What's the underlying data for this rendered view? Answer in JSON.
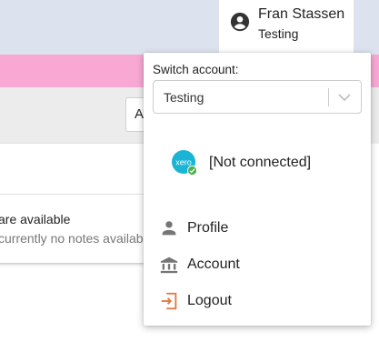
{
  "user": {
    "name": "Fran Stassen",
    "organisation": "Testing"
  },
  "menu": {
    "switch_label": "Switch account:",
    "selected_account": "Testing",
    "connection": {
      "status_text": "[Not connected]",
      "logo_text": "xero"
    },
    "items": [
      {
        "label": "Profile",
        "icon": "person-icon"
      },
      {
        "label": "Account",
        "icon": "bank-icon"
      },
      {
        "label": "Logout",
        "icon": "logout-icon"
      }
    ]
  },
  "background": {
    "header_button_text": "A",
    "notes_title": "are available",
    "notes_subtitle": "currently no notes available"
  },
  "colors": {
    "top_bar": "#dde3ee",
    "pink_bar": "#f9a8d4",
    "xero_blue": "#1ab4d7",
    "connected_green": "#4caf50",
    "logout_orange": "#e8743b",
    "icon_grey": "#757575"
  }
}
